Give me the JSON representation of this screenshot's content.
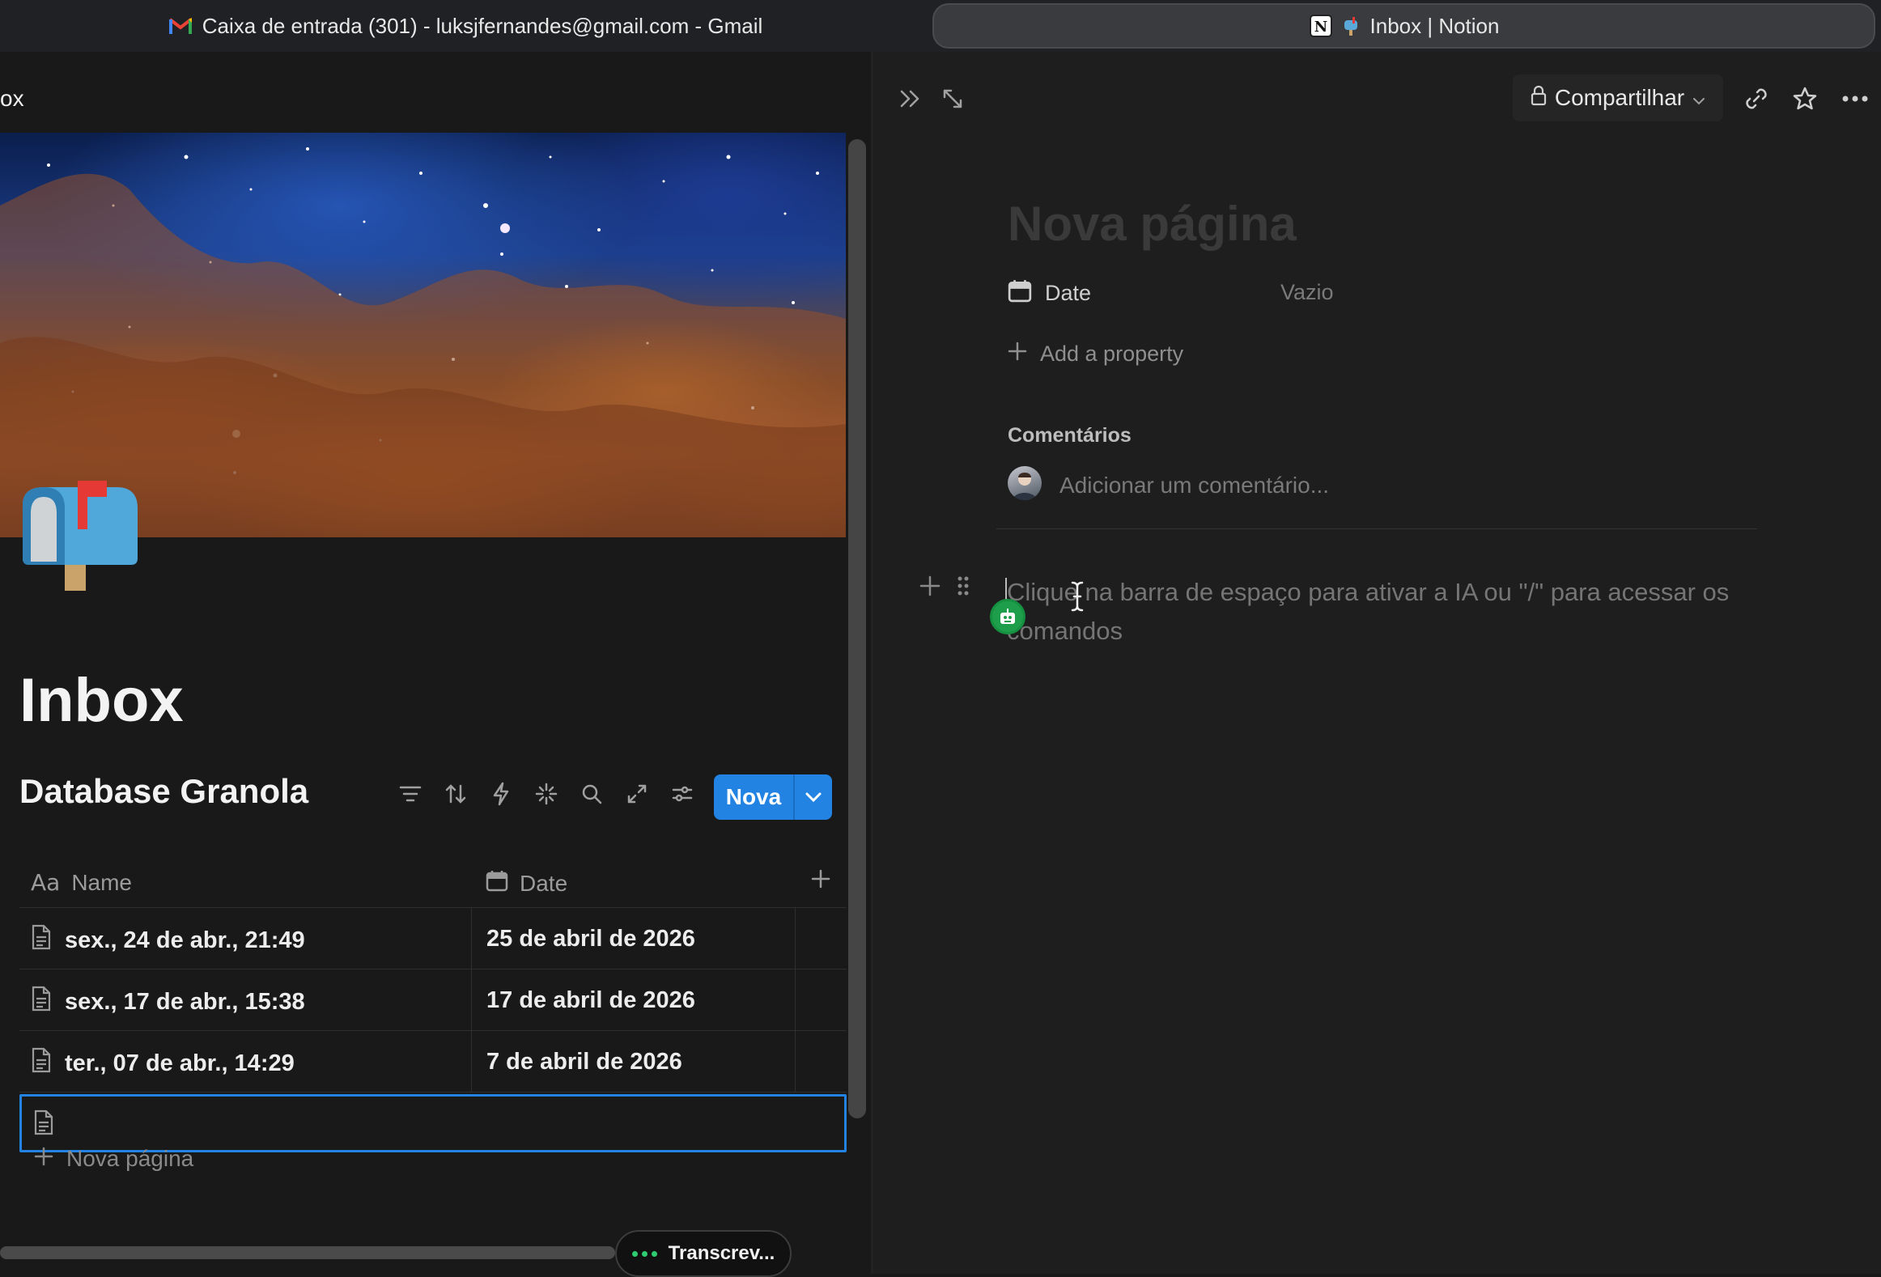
{
  "browser": {
    "tabs": [
      {
        "label": "Caixa de entrada (301) - luksjfernandes@gmail.com - Gmail",
        "icon": "gmail-icon"
      },
      {
        "label": "Inbox | Notion",
        "icon": "notion-icon",
        "active": true
      }
    ]
  },
  "left": {
    "breadcrumb": "ox",
    "page_icon": "mailbox-icon",
    "title": "Inbox",
    "database": {
      "title": "Database Granola",
      "tools": [
        "filter-icon",
        "sort-icon",
        "automation-icon",
        "ai-sparkle-icon",
        "search-icon",
        "expand-icon",
        "settings-icon"
      ],
      "new_button": "Nova",
      "columns": [
        {
          "label": "Name",
          "icon": "text-type-icon"
        },
        {
          "label": "Date",
          "icon": "calendar-icon"
        }
      ],
      "rows": [
        {
          "name": "sex., 24 de abr., 21:49",
          "date": "25 de abril de 2026"
        },
        {
          "name": "sex., 17 de abr., 15:38",
          "date": "17 de abril de 2026"
        },
        {
          "name": "ter., 07 de abr., 14:29",
          "date": "7 de abril de 2026"
        }
      ],
      "new_page": "Nova página"
    },
    "transcribe_pill": "Transcrev..."
  },
  "right": {
    "share_button": "Compartilhar",
    "title_placeholder": "Nova página",
    "properties": [
      {
        "label": "Date",
        "value": "Vazio",
        "icon": "calendar-icon"
      }
    ],
    "add_property": "Add a property",
    "comments_heading": "Comentários",
    "comment_placeholder": "Adicionar um comentário...",
    "editor_placeholder": "Clique na barra de espaço para ativar a IA ou \"/\" para acessar os comandos"
  },
  "colors": {
    "accent": "#2383e2",
    "background": "#191919",
    "panel": "#1e1e1e",
    "ai_badge": "#1e9e4a"
  }
}
